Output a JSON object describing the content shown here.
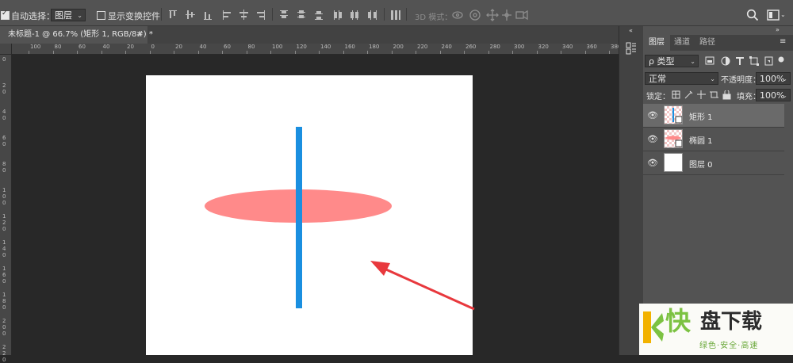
{
  "options_bar": {
    "auto_select_label": "自动选择：",
    "auto_select_checked": true,
    "auto_select_target": "图层",
    "show_transform_label": "显示变换控件",
    "show_transform_checked": false,
    "mode_3d_label": "3D 模式："
  },
  "document": {
    "tab_title": "未标题-1 @ 66.7% (矩形 1, RGB/8#) *",
    "close_glyph": "×",
    "ruler_top_labels": [
      "100",
      "80",
      "60",
      "40",
      "20",
      "0",
      "20",
      "40",
      "60",
      "80",
      "100",
      "120",
      "140",
      "160",
      "180",
      "200",
      "220",
      "240",
      "260",
      "280",
      "300",
      "320",
      "340",
      "360",
      "380"
    ],
    "ruler_left_labels": [
      "0",
      "2\n0",
      "4\n0",
      "6\n0",
      "8\n0",
      "1\n0\n0",
      "1\n2\n0",
      "1\n4\n0",
      "1\n6\n0",
      "1\n8\n0",
      "2\n0\n0",
      "2\n2\n0"
    ]
  },
  "canvas_shapes": {
    "ellipse_color": "#ff8a8a",
    "rect_color": "#1a8fe0",
    "arrow_color": "#e8383d"
  },
  "layers_panel": {
    "tabs": [
      "图层",
      "通道",
      "路径"
    ],
    "active_tab": "图层",
    "filter_label": "ρ 类型",
    "blend_mode": "正常",
    "opacity_label": "不透明度：",
    "opacity_value": "100%",
    "lock_label": "锁定：",
    "fill_label": "填充：",
    "fill_value": "100%",
    "layers": [
      {
        "name": "矩形 1",
        "selected": true,
        "visible": true
      },
      {
        "name": "椭圆 1",
        "selected": false,
        "visible": true
      },
      {
        "name": "图层 0",
        "selected": false,
        "visible": true
      }
    ]
  },
  "watermark": {
    "brand": "快盘下载",
    "brand_k": "快",
    "brand_rest": "盘下载",
    "slogan": "绿色·安全·高速"
  }
}
